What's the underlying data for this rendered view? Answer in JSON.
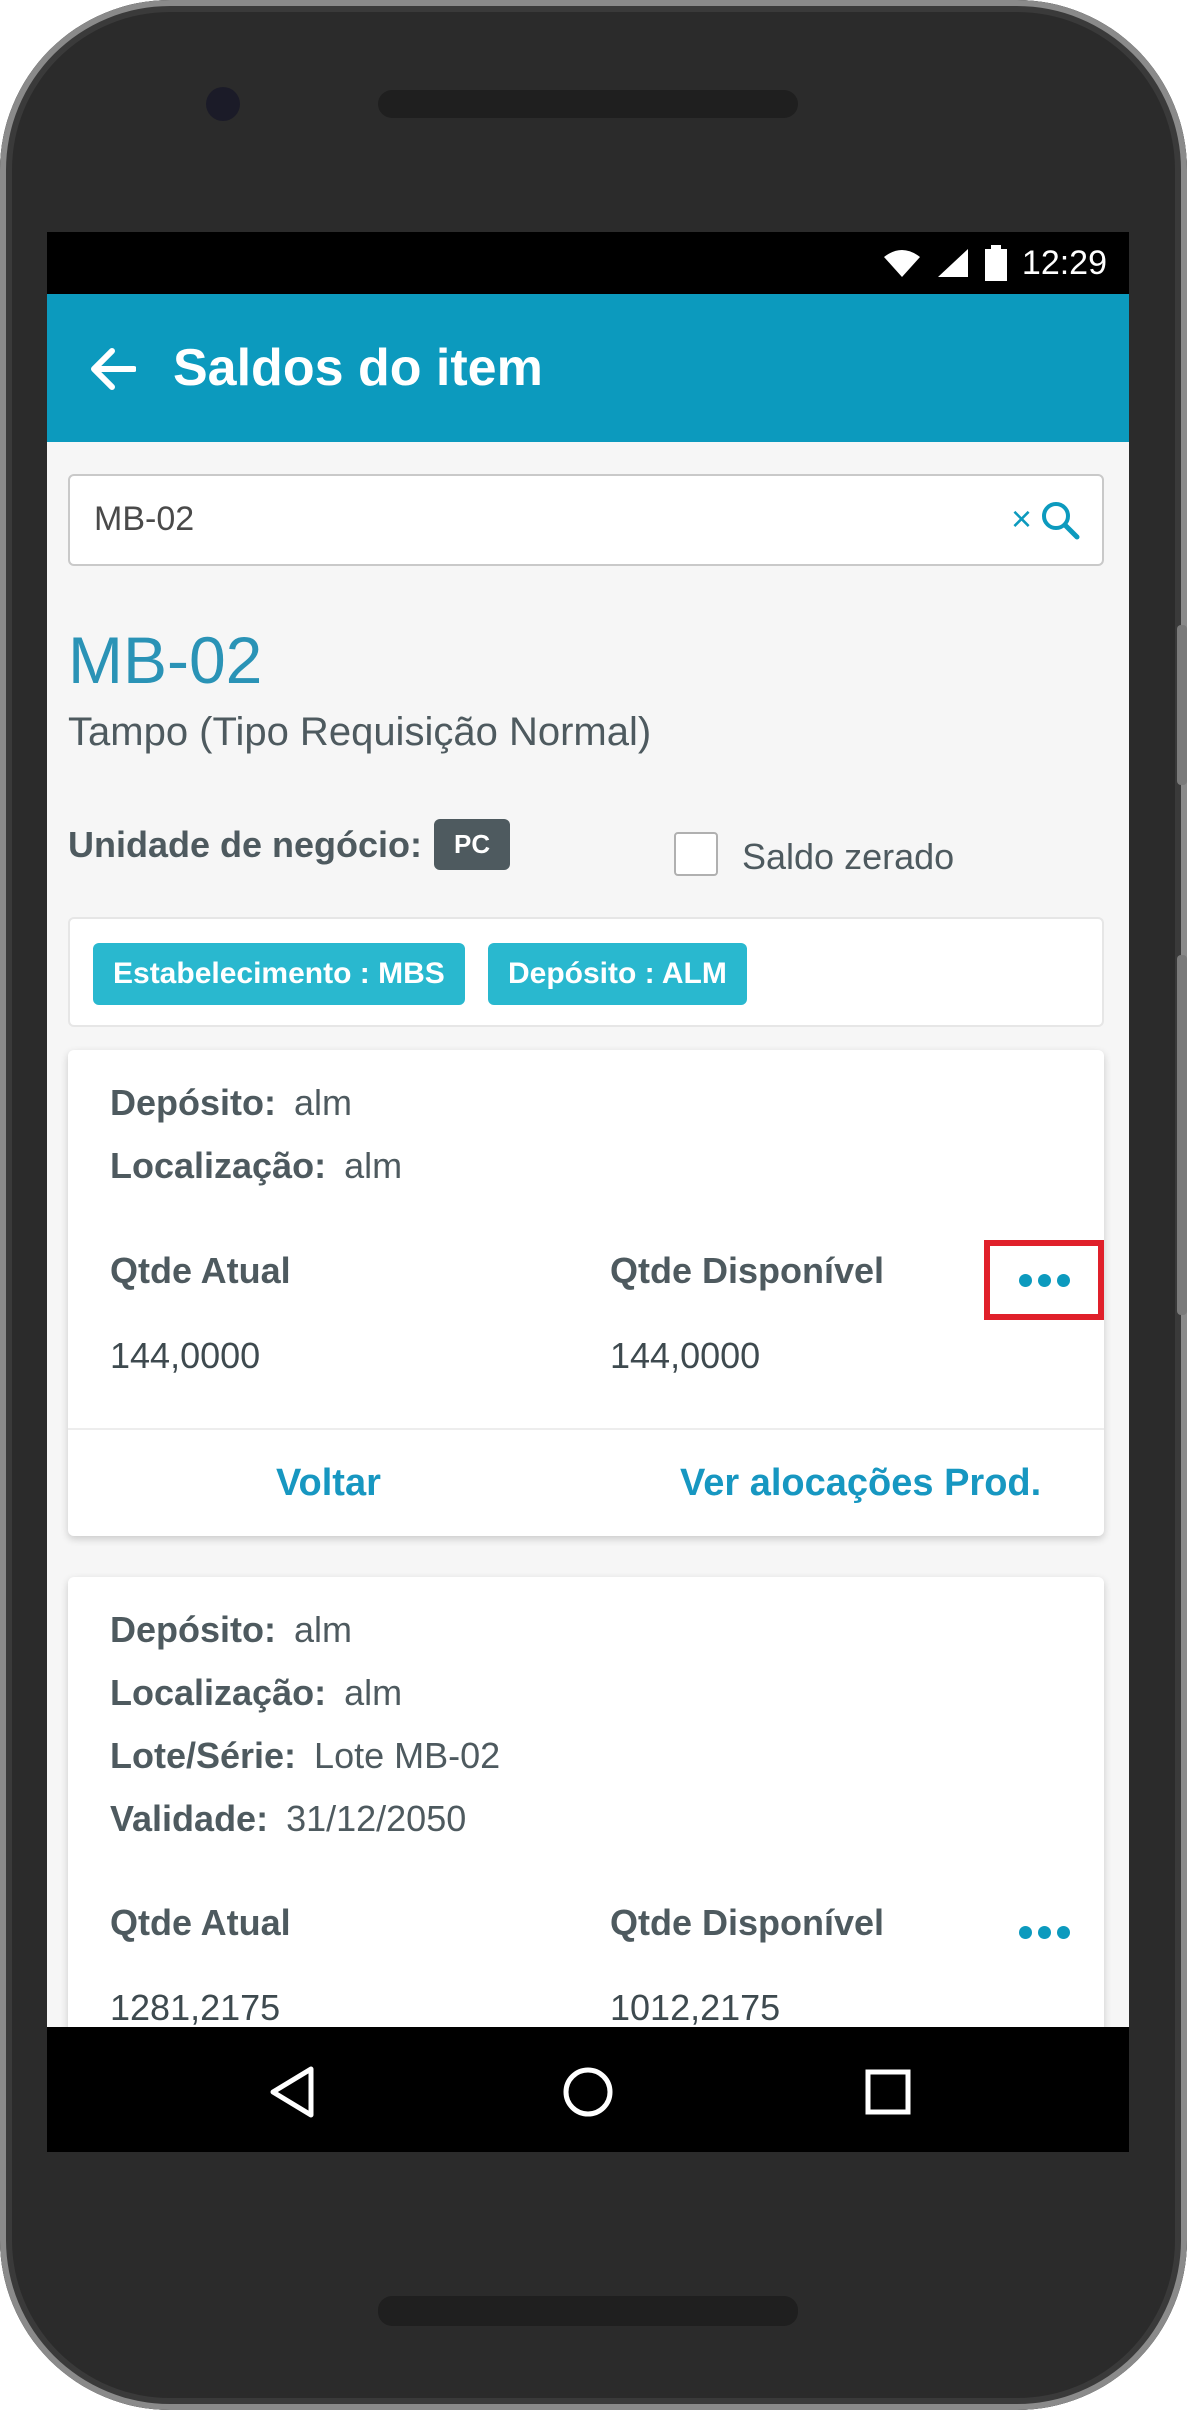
{
  "status_bar": {
    "time": "12:29"
  },
  "app_bar": {
    "title": "Saldos do item"
  },
  "search": {
    "value": "MB-02",
    "clear_glyph": "×"
  },
  "item": {
    "code": "MB-02",
    "description": "Tampo (Tipo Requisição Normal)",
    "unit_label": "Unidade de negócio:",
    "unit_value": "PC",
    "zero_balance_label": "Saldo zerado",
    "zero_balance_checked": false
  },
  "filters": [
    {
      "label": "Estabelecimento : MBS"
    },
    {
      "label": "Depósito : ALM"
    }
  ],
  "cards": [
    {
      "deposito_label": "Depósito:",
      "deposito": "alm",
      "localizacao_label": "Localização:",
      "localizacao": "alm",
      "qtde_atual_label": "Qtde Atual",
      "qtde_atual": "144,0000",
      "qtde_disponivel_label": "Qtde Disponível",
      "qtde_disponivel": "144,0000",
      "action_back": "Voltar",
      "action_alloc": "Ver alocações Prod."
    },
    {
      "deposito_label": "Depósito:",
      "deposito": "alm",
      "localizacao_label": "Localização:",
      "localizacao": "alm",
      "lote_label": "Lote/Série:",
      "lote": "Lote MB-02",
      "validade_label": "Validade:",
      "validade": "31/12/2050",
      "qtde_atual_label": "Qtde Atual",
      "qtde_atual": "1281,2175",
      "qtde_disponivel_label": "Qtde Disponível",
      "qtde_disponivel": "1012,2175"
    }
  ],
  "colors": {
    "app_bar": "#0c9abe",
    "accent": "#1797c1",
    "chip": "#29b8cf",
    "highlight": "#e0202a"
  },
  "icons": [
    "back-arrow-icon",
    "search-icon",
    "close-icon",
    "more-dots-icon",
    "wifi-icon",
    "signal-icon",
    "battery-icon",
    "nav-back-icon",
    "nav-home-icon",
    "nav-recents-icon"
  ]
}
